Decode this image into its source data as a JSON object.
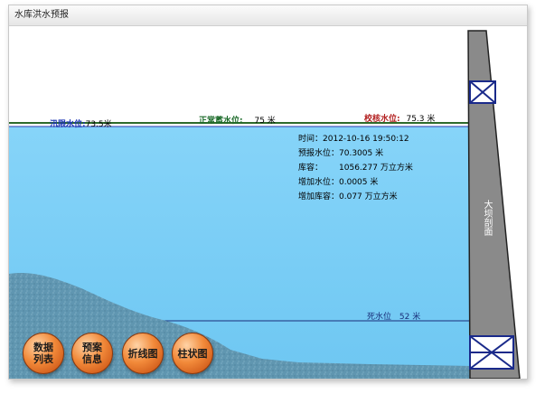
{
  "window": {
    "title": "水库洪水预报"
  },
  "levels": {
    "flood_limit": {
      "label": "汛限水位:",
      "value": "73.5米"
    },
    "normal_storage": {
      "label": "正常蓄水位:",
      "value": "75 米"
    },
    "check_flood": {
      "label": "校核水位:",
      "value": "75.3 米"
    },
    "dead_water": {
      "label": "死水位",
      "value": "52 米"
    }
  },
  "forecast": {
    "time": {
      "label": "时间：",
      "value": "2012-10-16 19:50:12"
    },
    "forecast_level": {
      "label": "预报水位：",
      "value": "70.3005 米"
    },
    "storage": {
      "label": "库容：",
      "value": "1056.277 万立方米"
    },
    "added_level": {
      "label": "增加水位：",
      "value": "0.0005 米"
    },
    "added_storage": {
      "label": "增加库容：",
      "value": "0.077 万立方米"
    }
  },
  "dam": {
    "label": "大坝剖面"
  },
  "buttons": {
    "data_list": "数据列表",
    "plan_info": "预案信息",
    "line_chart": "折线图",
    "bar_chart": "柱状图"
  },
  "colors": {
    "water": "#7fd0f7",
    "terrain": "#5f93ad",
    "dam": "#8a8a8a",
    "button": "#f28a3a"
  }
}
